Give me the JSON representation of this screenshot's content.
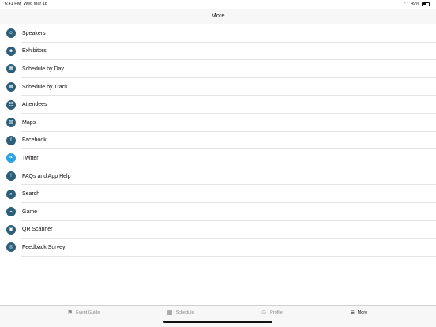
{
  "status": {
    "time": "6:41 PM",
    "date": "Wed Mar 18",
    "battery": "49%",
    "battery_level": 0.49
  },
  "nav": {
    "title": "More"
  },
  "menu": [
    {
      "label": "Speakers",
      "icon": "speaker-icon",
      "glyph": "☺"
    },
    {
      "label": "Exhibitors",
      "icon": "exhibitor-icon",
      "glyph": "☻"
    },
    {
      "label": "Schedule by Day",
      "icon": "calendar-icon",
      "glyph": "▦"
    },
    {
      "label": "Schedule by Track",
      "icon": "track-calendar-icon",
      "glyph": "▦"
    },
    {
      "label": "Attendees",
      "icon": "attendees-icon",
      "glyph": "☷"
    },
    {
      "label": "Maps",
      "icon": "map-icon",
      "glyph": "▧"
    },
    {
      "label": "Facebook",
      "icon": "facebook-icon",
      "glyph": "f"
    },
    {
      "label": "Twitter",
      "icon": "twitter-icon",
      "glyph": "❧"
    },
    {
      "label": "FAQs and App Help",
      "icon": "help-icon",
      "glyph": "!"
    },
    {
      "label": "Search",
      "icon": "search-icon",
      "glyph": "⌕"
    },
    {
      "label": "Game",
      "icon": "game-icon",
      "glyph": "◒"
    },
    {
      "label": "QR Scanner",
      "icon": "qr-icon",
      "glyph": "▣"
    },
    {
      "label": "Feedback Survey",
      "icon": "feedback-icon",
      "glyph": "◎"
    }
  ],
  "tabs": [
    {
      "label": "Event Guide",
      "icon": "event-guide-icon",
      "glyph": "⚑",
      "active": false
    },
    {
      "label": "Schedule",
      "icon": "schedule-icon",
      "glyph": "▦",
      "active": false
    },
    {
      "label": "Profile",
      "icon": "profile-icon",
      "glyph": "☺",
      "active": false
    },
    {
      "label": "More",
      "icon": "more-icon",
      "glyph": "≡",
      "active": true
    }
  ],
  "colors": {
    "icon_bg": "#2e5f78",
    "twitter": "#2aa3e0",
    "active_tab": "#111111",
    "inactive_tab": "#8a8a8a"
  }
}
